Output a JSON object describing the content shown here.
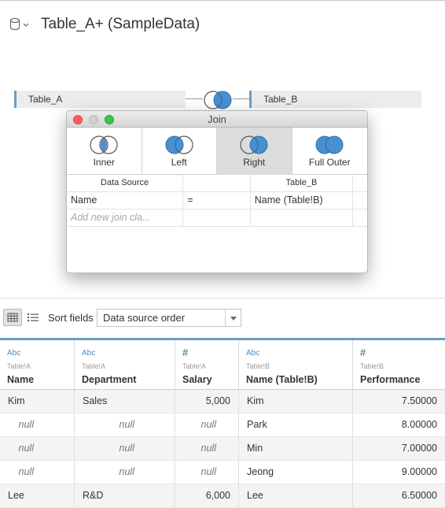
{
  "header": {
    "title": "Table_A+ (SampleData)",
    "icon": "database-icon"
  },
  "canvas": {
    "left_table": "Table_A",
    "right_table": "Table_B",
    "join_icon": "right-join-icon"
  },
  "dialog": {
    "title": "Join",
    "join_types": [
      {
        "label": "Inner",
        "selected": false
      },
      {
        "label": "Left",
        "selected": false
      },
      {
        "label": "Right",
        "selected": true
      },
      {
        "label": "Full Outer",
        "selected": false
      }
    ],
    "clause_headers": {
      "left": "Data Source",
      "right": "Table_B"
    },
    "clause": {
      "left": "Name",
      "operator": "=",
      "right": "Name (Table!B)"
    },
    "add_placeholder": "Add new join cla..."
  },
  "toolbar": {
    "sort_label": "Sort fields",
    "sort_value": "Data source order"
  },
  "colors": {
    "accent": "#6a9ec6",
    "join_fill": "#4a90d0",
    "close": "#fc5f57",
    "max": "#34c84a"
  },
  "grid": {
    "columns": [
      {
        "type": "Abc",
        "source": "Table!A",
        "name": "Name"
      },
      {
        "type": "Abc",
        "source": "Table!A",
        "name": "Department"
      },
      {
        "type": "#",
        "source": "Table!A",
        "name": "Salary"
      },
      {
        "type": "Abc",
        "source": "Table!B",
        "name": "Name (Table!B)"
      },
      {
        "type": "#",
        "source": "Table!B",
        "name": "Performance"
      }
    ],
    "rows": [
      [
        "Kim",
        "Sales",
        "5,000",
        "Kim",
        "7.50000"
      ],
      [
        "null",
        "null",
        "null",
        "Park",
        "8.00000"
      ],
      [
        "null",
        "null",
        "null",
        "Min",
        "7.00000"
      ],
      [
        "null",
        "null",
        "null",
        "Jeong",
        "9.00000"
      ],
      [
        "Lee",
        "R&D",
        "6,000",
        "Lee",
        "6.50000"
      ]
    ]
  }
}
